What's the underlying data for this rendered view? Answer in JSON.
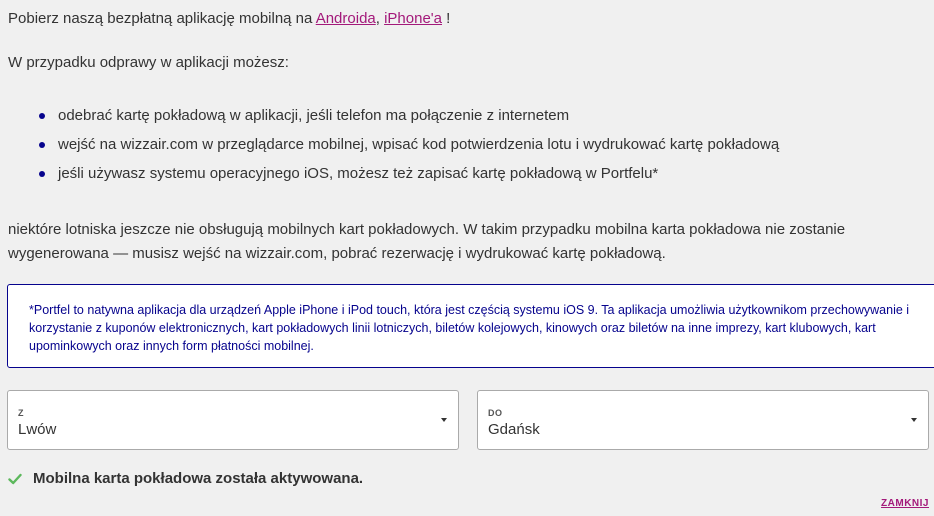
{
  "intro": {
    "prefix": "Pobierz naszą bezpłatną aplikację mobilną na ",
    "link_android": "Androida",
    "separator": ", ",
    "link_iphone": "iPhone'a",
    "suffix": " !"
  },
  "subhead": "W przypadku odprawy w aplikacji możesz:",
  "bullets": [
    "odebrać kartę pokładową w aplikacji, jeśli telefon ma połączenie z internetem",
    "wejść na wizzair.com w przeglądarce mobilnej, wpisać kod potwierdzenia lotu i wydrukować kartę pokładową",
    "jeśli używasz systemu operacyjnego iOS, możesz też zapisać kartę pokładową w Portfelu*"
  ],
  "note": "niektóre lotniska jeszcze nie obsługują mobilnych kart pokładowych. W takim przypadku mobilna karta pokładowa nie zostanie wygenerowana — musisz wejść na wizzair.com, pobrać rezerwację i wydrukować kartę pokładową.",
  "info_box": "*Portfel  to natywna aplikacja dla urządzeń Apple iPhone i iPod touch, która jest częścią systemu iOS 9. Ta aplikacja umożliwia użytkownikom przechowywanie i korzystanie z kuponów elektronicznych, kart pokładowych linii lotniczych, biletów kolejowych, kinowych oraz biletów na inne imprezy, kart klubowych, kart upominkowych oraz innych form płatności mobilnej.",
  "from_select": {
    "label": "Z",
    "value": "Lwów"
  },
  "to_select": {
    "label": "DO",
    "value": "Gdańsk"
  },
  "status": {
    "icon": "check-icon",
    "text": "Mobilna karta pokładowa została aktywowana."
  },
  "close_label": "ZAMKNIJ",
  "colors": {
    "link": "#a3197a",
    "accent_blue": "#06038d",
    "check_green": "#5cb85c"
  }
}
